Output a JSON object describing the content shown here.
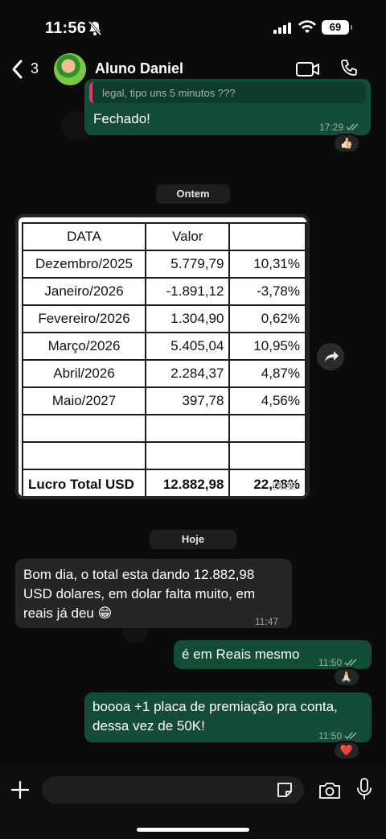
{
  "status_bar": {
    "time": "11:56",
    "battery": "69"
  },
  "header": {
    "back_count": "3",
    "contact_name": "Aluno Daniel"
  },
  "messages": {
    "m1": {
      "quote_text": "legal, tipo uns 5 minutos ???",
      "text": "Fechado!",
      "time": "17:29",
      "reaction": "👍🏻"
    },
    "date_yesterday": "Ontem",
    "image": {
      "time": "10:39",
      "table": {
        "headers": [
          "DATA",
          "Valor",
          ""
        ],
        "rows": [
          [
            "Dezembro/2025",
            "5.779,79",
            "10,31%"
          ],
          [
            "Janeiro/2026",
            "-1.891,12",
            "-3,78%"
          ],
          [
            "Fevereiro/2026",
            "1.304,90",
            "0,62%"
          ],
          [
            "Março/2026",
            "5.405,04",
            "10,95%"
          ],
          [
            "Abril/2026",
            "2.284,37",
            "4,87%"
          ],
          [
            "Maio/2027",
            "397,78",
            "4,56%"
          ]
        ],
        "total": [
          "Lucro Total USD",
          "12.882,98",
          "22,28%"
        ]
      }
    },
    "date_today": "Hoje",
    "m2": {
      "lines": [
        "Bom dia,  o total esta dando 12.882,98",
        "USD dolares, em dolar falta muito, em",
        "reais já deu 😁"
      ],
      "time": "11:47"
    },
    "m3": {
      "text": "é em Reais mesmo",
      "time": "11:50",
      "reaction": "🙏🏻"
    },
    "m4": {
      "lines": [
        "boooa +1 placa de premiação pra conta,",
        "dessa vez de 50K!"
      ],
      "time": "11:50",
      "reaction": "❤️"
    }
  },
  "input": {
    "placeholder": ""
  },
  "colors": {
    "outgoing": "#134d37",
    "incoming": "#242626",
    "background": "#0b0b0b"
  }
}
